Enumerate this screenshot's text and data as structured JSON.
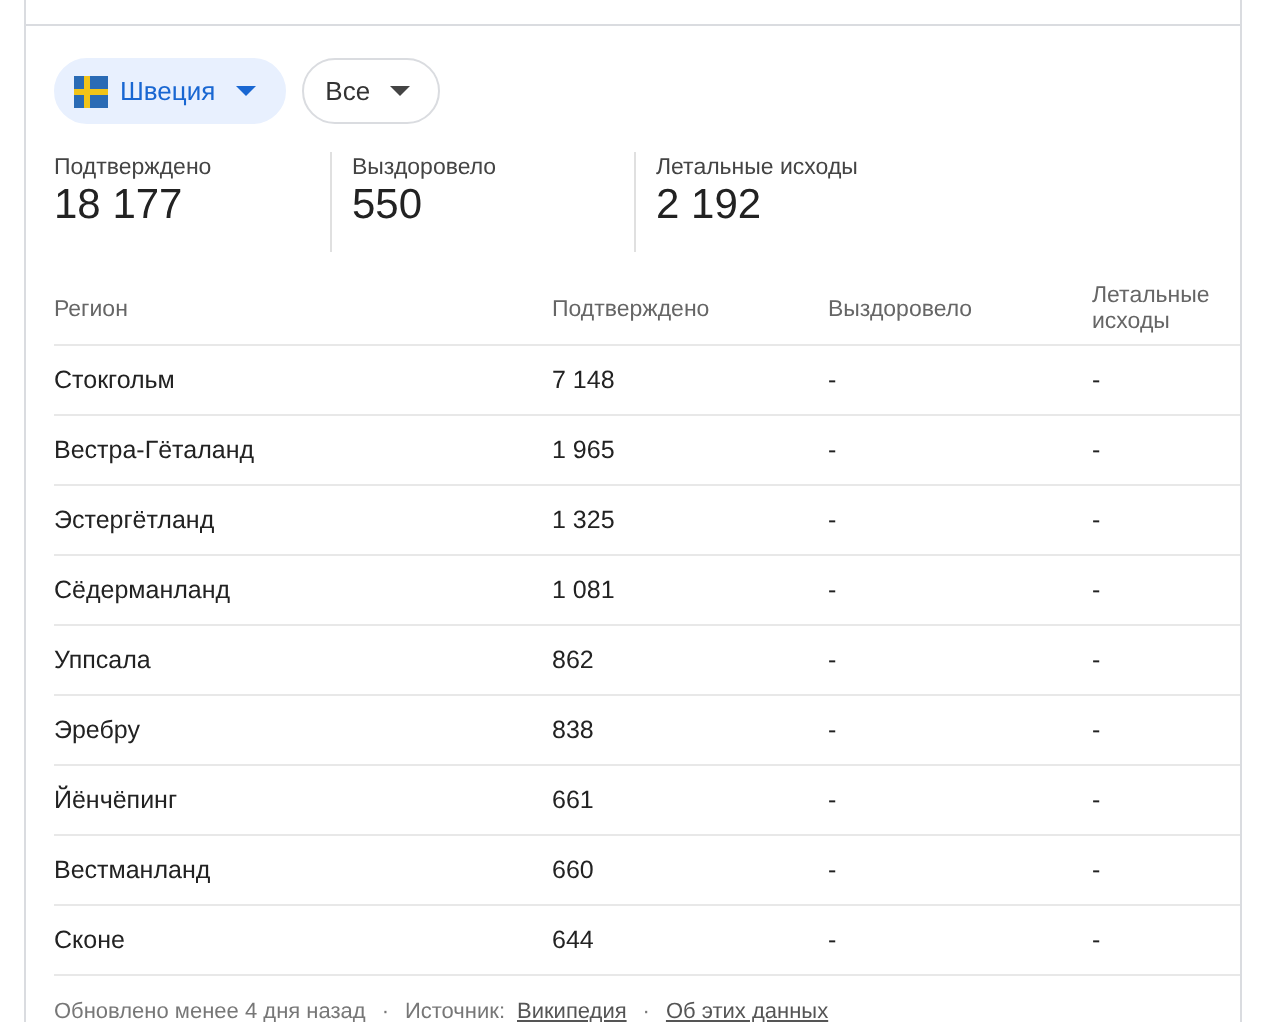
{
  "filters": [
    {
      "label": "Швеция",
      "kind": "country",
      "selected": true
    },
    {
      "label": "Все",
      "kind": "plain",
      "selected": false
    }
  ],
  "stats": [
    {
      "label": "Подтверждено",
      "value": "18 177"
    },
    {
      "label": "Выздоровело",
      "value": "550"
    },
    {
      "label": "Летальные исходы",
      "value": "2 192"
    }
  ],
  "table": {
    "columns": [
      "Регион",
      "Подтверждено",
      "Выздоровело",
      "Летальные исходы"
    ],
    "rows": [
      [
        "Стокгольм",
        "7 148",
        "-",
        "-"
      ],
      [
        "Вестра-Гёталанд",
        "1 965",
        "-",
        "-"
      ],
      [
        "Эстергётланд",
        "1 325",
        "-",
        "-"
      ],
      [
        "Сёдерманланд",
        "1 081",
        "-",
        "-"
      ],
      [
        "Уппсала",
        "862",
        "-",
        "-"
      ],
      [
        "Эребру",
        "838",
        "-",
        "-"
      ],
      [
        "Йёнчёпинг",
        "661",
        "-",
        "-"
      ],
      [
        "Вестманланд",
        "660",
        "-",
        "-"
      ],
      [
        "Сконе",
        "644",
        "-",
        "-"
      ]
    ]
  },
  "footer": {
    "updated": "Обновлено менее 4 дня назад",
    "separator_1": "·",
    "source_label": "Источник:",
    "source_link": "Википедия",
    "separator_2": "·",
    "about_link": "Об этих данных"
  }
}
